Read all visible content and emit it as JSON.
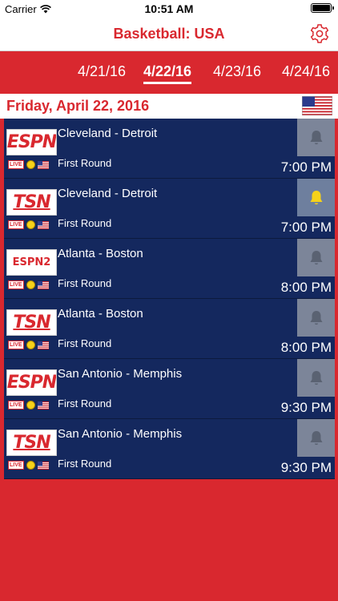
{
  "status": {
    "carrier": "Carrier",
    "time": "10:51 AM",
    "battery_level": 1.0
  },
  "nav": {
    "title": "Basketball: USA",
    "settings_icon": "gear-icon"
  },
  "date_tabs": [
    {
      "label": "4/21/16",
      "active": false
    },
    {
      "label": "4/22/16",
      "active": true
    },
    {
      "label": "4/23/16",
      "active": false
    },
    {
      "label": "4/24/16",
      "active": false
    }
  ],
  "day_header": {
    "title": "Friday, April 22, 2016",
    "flag_icon": "us-flag-icon"
  },
  "colors": {
    "brand_red": "#d9282f",
    "row_blue": "#14285e",
    "bell_inactive": "#5a6272",
    "bell_active": "#f6d21a"
  },
  "games": [
    {
      "channel": "ESPN",
      "matchup": "Cleveland - Detroit",
      "live_badge": "LIVE",
      "round": "First Round",
      "time": "7:00 PM",
      "bell_active": false
    },
    {
      "channel": "TSN",
      "matchup": "Cleveland - Detroit",
      "live_badge": "LIVE",
      "round": "First Round",
      "time": "7:00 PM",
      "bell_active": true
    },
    {
      "channel": "ESPN2",
      "matchup": "Atlanta - Boston",
      "live_badge": "LIVE",
      "round": "First Round",
      "time": "8:00 PM",
      "bell_active": false
    },
    {
      "channel": "TSN",
      "matchup": "Atlanta - Boston",
      "live_badge": "LIVE",
      "round": "First Round",
      "time": "8:00 PM",
      "bell_active": false
    },
    {
      "channel": "ESPN",
      "matchup": "San Antonio - Memphis",
      "live_badge": "LIVE",
      "round": "First Round",
      "time": "9:30 PM",
      "bell_active": false
    },
    {
      "channel": "TSN",
      "matchup": "San Antonio - Memphis",
      "live_badge": "LIVE",
      "round": "First Round",
      "time": "9:30 PM",
      "bell_active": false
    }
  ]
}
